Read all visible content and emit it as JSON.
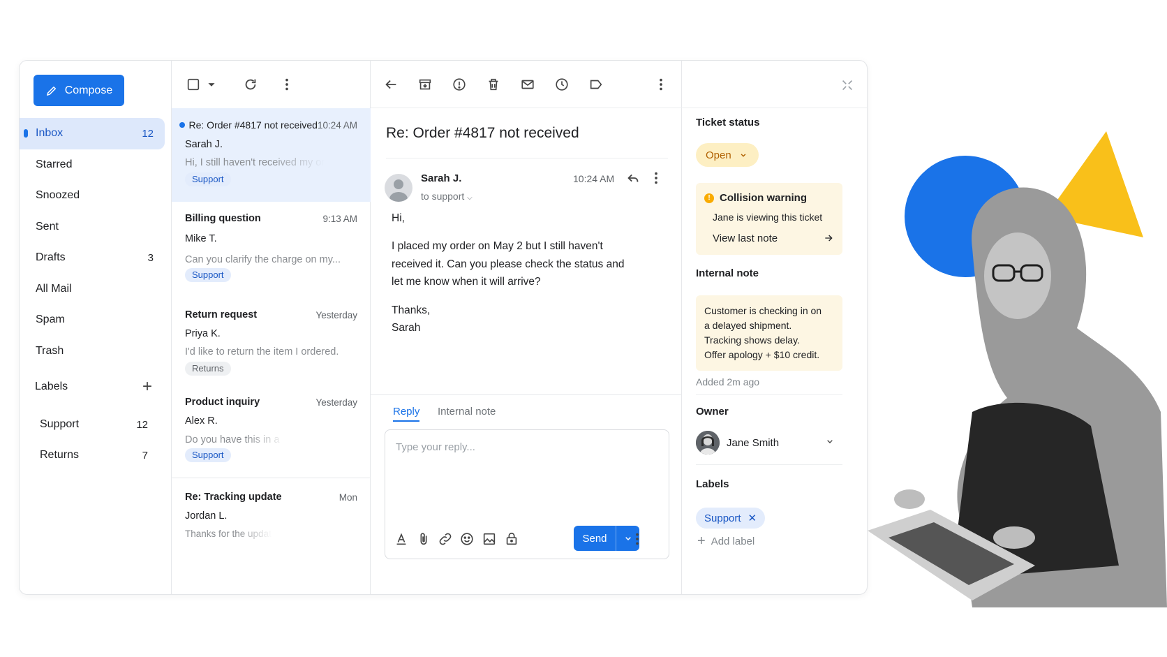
{
  "sidebar": {
    "compose_label": "Compose",
    "nav": [
      {
        "label": "Inbox",
        "count": "12",
        "active": true
      },
      {
        "label": "Starred",
        "count": ""
      },
      {
        "label": "Snoozed",
        "count": ""
      },
      {
        "label": "Sent",
        "count": ""
      },
      {
        "label": "Drafts",
        "count": "3"
      },
      {
        "label": "All Mail",
        "count": ""
      },
      {
        "label": "Spam",
        "count": ""
      },
      {
        "label": "Trash",
        "count": ""
      }
    ],
    "labels_title": "Labels",
    "labels": [
      {
        "label": "Support",
        "count": "12"
      },
      {
        "label": "Returns",
        "count": "7"
      }
    ]
  },
  "messages": [
    {
      "subject": "Re: Order #4817 not received",
      "time": "10:24 AM",
      "sender": "Sarah J.",
      "snippet": "Hi, I still haven't received my order",
      "chip": "Support"
    },
    {
      "subject": "Billing question",
      "time": "9:13 AM",
      "sender": "Mike T.",
      "snippet": "Can you clarify the charge on my...",
      "chip": "Support"
    },
    {
      "subject": "Return request",
      "time": "Yesterday",
      "sender": "Priya K.",
      "snippet": "I'd like to return the item I ordered.",
      "chip": "Returns"
    },
    {
      "subject": "Product inquiry",
      "time": "Yesterday",
      "sender": "Alex R.",
      "snippet": "Do you have this in a",
      "chip": "Support"
    },
    {
      "subject": "Re: Tracking update",
      "time": "Mon",
      "sender": "Jordan L.",
      "snippet": "Thanks for the update"
    }
  ],
  "reader": {
    "subject": "Re: Order #4817 not received",
    "from": "Sarah J.",
    "to": "to support",
    "time": "10:24 AM",
    "body": {
      "greeting": "Hi,",
      "line1": "I placed my order on May 2 but I still haven't",
      "line2": "received it. Can you please check the status and",
      "line3": "let me know when it will arrive?",
      "closing": "Thanks,",
      "signature": "Sarah"
    },
    "tabs": {
      "reply": "Reply",
      "note": "Internal note"
    },
    "reply_placeholder": "Type your reply...",
    "send_label": "Send"
  },
  "panel": {
    "status_title": "Ticket status",
    "status_value": "Open",
    "collision_title": "Collision warning",
    "collision_text": "Jane is viewing this ticket",
    "collision_link": "View last note",
    "note_title": "Internal note",
    "note_lines": [
      "Customer is checking in on",
      "a delayed shipment.",
      "Tracking shows delay.",
      "Offer apology + $10 credit."
    ],
    "note_added": "Added 2m ago",
    "owner_title": "Owner",
    "owner_name": "Jane Smith",
    "labels_title": "Labels",
    "label_chip": "Support",
    "add_label": "Add label"
  },
  "colors": {
    "accent": "#1a73e8",
    "status_open": "#fdefc3",
    "art_blue": "#1a73e8",
    "art_yellow": "#f9c01a"
  }
}
